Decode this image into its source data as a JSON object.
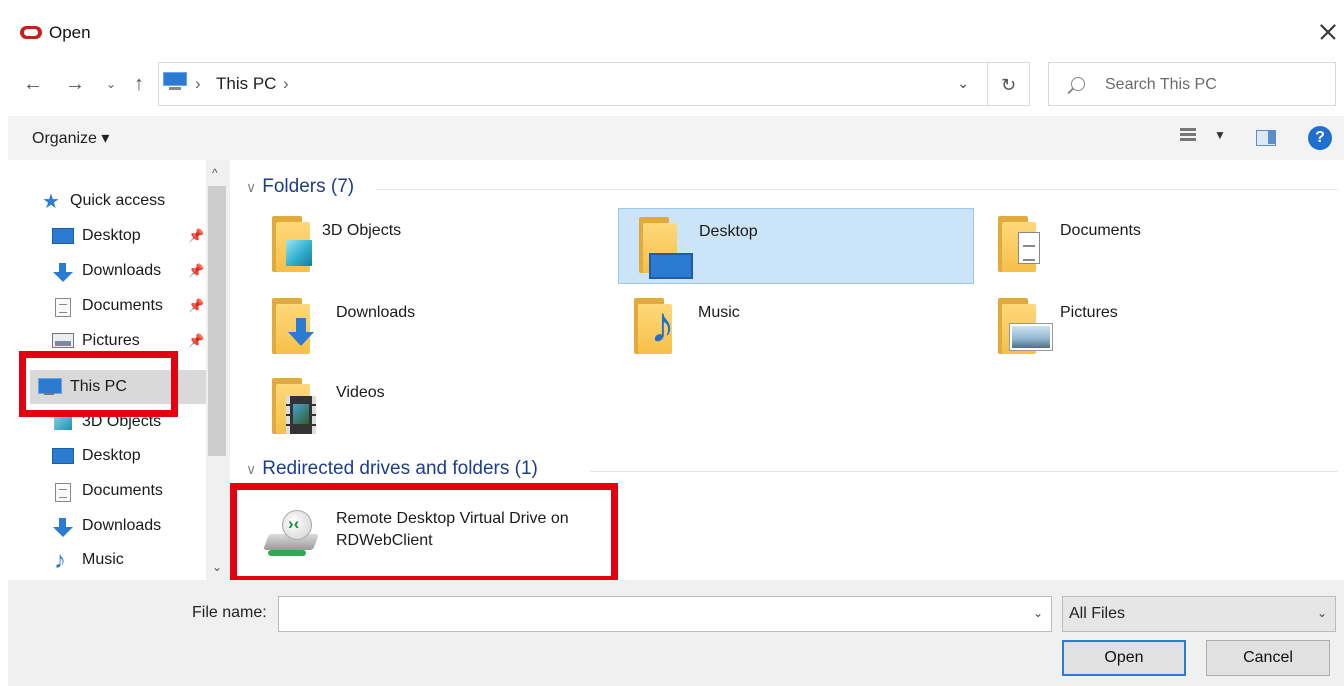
{
  "window": {
    "title": "Open"
  },
  "address": {
    "crumb": "This PC",
    "sep": "›"
  },
  "search": {
    "placeholder": "Search This PC"
  },
  "toolbar": {
    "organize_label": "Organize ▾"
  },
  "sidebar": {
    "items": [
      {
        "label": "Quick access",
        "icon": "quick-access-icon"
      },
      {
        "label": "Desktop",
        "icon": "desktop-icon",
        "pinned": true
      },
      {
        "label": "Downloads",
        "icon": "downloads-icon",
        "pinned": true
      },
      {
        "label": "Documents",
        "icon": "documents-icon",
        "pinned": true
      },
      {
        "label": "Pictures",
        "icon": "pictures-icon",
        "pinned": true
      },
      {
        "label": "This PC",
        "icon": "this-pc-icon",
        "selected": true
      },
      {
        "label": "3D Objects",
        "icon": "3d-objects-icon"
      },
      {
        "label": "Desktop",
        "icon": "desktop-icon"
      },
      {
        "label": "Documents",
        "icon": "documents-icon"
      },
      {
        "label": "Downloads",
        "icon": "downloads-icon"
      },
      {
        "label": "Music",
        "icon": "music-icon"
      }
    ]
  },
  "folders_group": {
    "header": "Folders (7)",
    "items": [
      {
        "label": "3D Objects",
        "icon": "3d-objects-folder-icon"
      },
      {
        "label": "Desktop",
        "icon": "desktop-folder-icon",
        "selected": true
      },
      {
        "label": "Documents",
        "icon": "documents-folder-icon"
      },
      {
        "label": "Downloads",
        "icon": "downloads-folder-icon"
      },
      {
        "label": "Music",
        "icon": "music-folder-icon"
      },
      {
        "label": "Pictures",
        "icon": "pictures-folder-icon"
      },
      {
        "label": "Videos",
        "icon": "videos-folder-icon"
      }
    ]
  },
  "drives_group": {
    "header": "Redirected drives and folders (1)",
    "items": [
      {
        "line1": "Remote Desktop Virtual Drive on",
        "line2": "RDWebClient",
        "icon": "remote-drive-icon"
      }
    ]
  },
  "bottom": {
    "file_name_label": "File name:",
    "file_name_value": "",
    "filter_value": "All Files",
    "open_label": "Open",
    "cancel_label": "Cancel"
  },
  "colors": {
    "annotation": "#e3000f",
    "selection": "#cce4f7",
    "accent": "#2a7bd1"
  }
}
